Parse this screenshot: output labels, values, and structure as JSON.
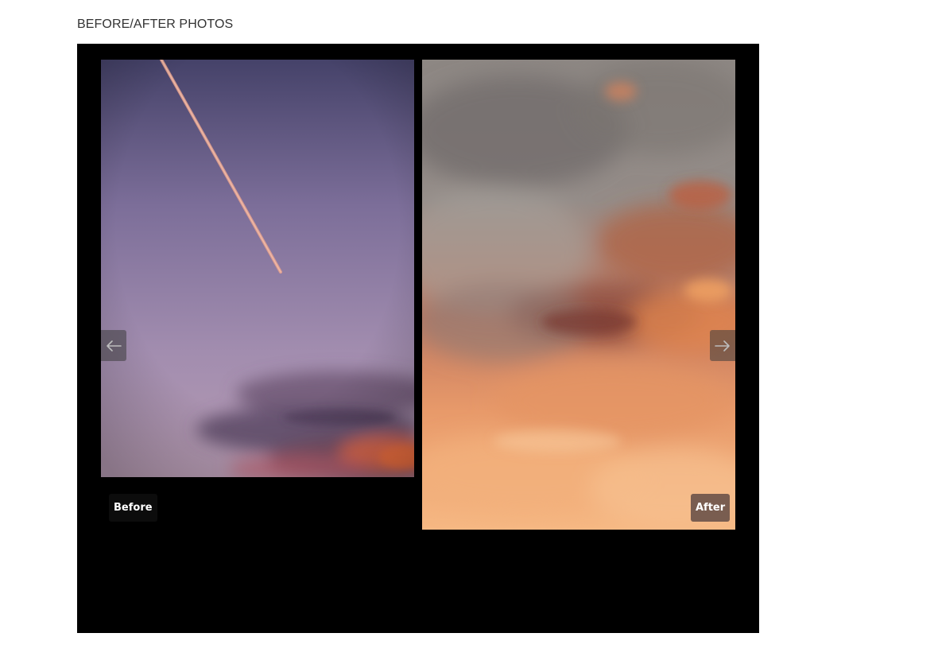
{
  "section": {
    "title": "BEFORE/AFTER PHOTOS"
  },
  "gallery": {
    "before_caption": "Before",
    "after_caption": "After",
    "prev_icon": "arrow-left-icon",
    "next_icon": "arrow-right-icon"
  },
  "colors": {
    "viewer_background": "#000000",
    "before_sky_top": "#4a4670",
    "before_sky_bottom": "#b89ab5",
    "after_sky_top": "#8a8580",
    "after_sky_bottom": "#f4b07a"
  }
}
